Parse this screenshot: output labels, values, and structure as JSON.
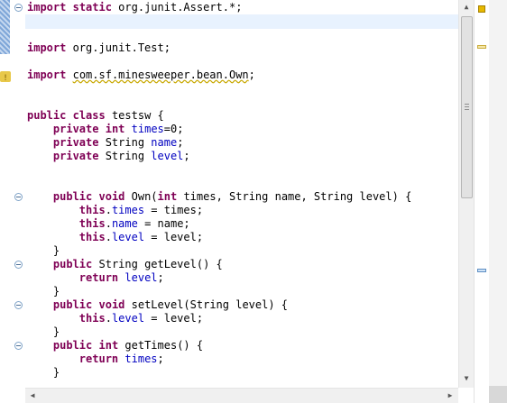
{
  "code_lines": [
    {
      "segments": [
        {
          "t": "import",
          "k": "kw"
        },
        {
          "t": " ",
          "k": ""
        },
        {
          "t": "static",
          "k": "kw"
        },
        {
          "t": " org.junit.Assert.*;",
          "k": ""
        }
      ]
    },
    {
      "segments": [
        {
          "t": "",
          "k": ""
        }
      ]
    },
    {
      "segments": [
        {
          "t": "",
          "k": ""
        }
      ]
    },
    {
      "segments": [
        {
          "t": "import",
          "k": "kw"
        },
        {
          "t": " org.junit.Test;",
          "k": ""
        }
      ]
    },
    {
      "segments": [
        {
          "t": "",
          "k": ""
        }
      ]
    },
    {
      "segments": [
        {
          "t": "import",
          "k": "kw"
        },
        {
          "t": " ",
          "k": ""
        },
        {
          "t": "com.sf.minesweeper.bean.Own",
          "k": "squig"
        },
        {
          "t": ";",
          "k": ""
        }
      ]
    },
    {
      "segments": [
        {
          "t": "",
          "k": ""
        }
      ]
    },
    {
      "segments": [
        {
          "t": "",
          "k": ""
        }
      ]
    },
    {
      "segments": [
        {
          "t": "public",
          "k": "kw"
        },
        {
          "t": " ",
          "k": ""
        },
        {
          "t": "class",
          "k": "kw"
        },
        {
          "t": " testsw {",
          "k": ""
        }
      ]
    },
    {
      "segments": [
        {
          "t": "    ",
          "k": ""
        },
        {
          "t": "private",
          "k": "kw"
        },
        {
          "t": " ",
          "k": ""
        },
        {
          "t": "int",
          "k": "kw"
        },
        {
          "t": " ",
          "k": ""
        },
        {
          "t": "times",
          "k": "fld"
        },
        {
          "t": "=0;",
          "k": ""
        }
      ]
    },
    {
      "segments": [
        {
          "t": "    ",
          "k": ""
        },
        {
          "t": "private",
          "k": "kw"
        },
        {
          "t": " String ",
          "k": ""
        },
        {
          "t": "name",
          "k": "fld"
        },
        {
          "t": ";",
          "k": ""
        }
      ]
    },
    {
      "segments": [
        {
          "t": "    ",
          "k": ""
        },
        {
          "t": "private",
          "k": "kw"
        },
        {
          "t": " String ",
          "k": ""
        },
        {
          "t": "level",
          "k": "fld"
        },
        {
          "t": ";",
          "k": ""
        }
      ]
    },
    {
      "segments": [
        {
          "t": "",
          "k": ""
        }
      ]
    },
    {
      "segments": [
        {
          "t": "",
          "k": ""
        }
      ]
    },
    {
      "segments": [
        {
          "t": "    ",
          "k": ""
        },
        {
          "t": "public",
          "k": "kw"
        },
        {
          "t": " ",
          "k": ""
        },
        {
          "t": "void",
          "k": "kw"
        },
        {
          "t": " Own(",
          "k": ""
        },
        {
          "t": "int",
          "k": "kw"
        },
        {
          "t": " times, String name, String level) {",
          "k": ""
        }
      ]
    },
    {
      "segments": [
        {
          "t": "        ",
          "k": ""
        },
        {
          "t": "this",
          "k": "kw"
        },
        {
          "t": ".",
          "k": ""
        },
        {
          "t": "times",
          "k": "fld"
        },
        {
          "t": " = times;",
          "k": ""
        }
      ]
    },
    {
      "segments": [
        {
          "t": "        ",
          "k": ""
        },
        {
          "t": "this",
          "k": "kw"
        },
        {
          "t": ".",
          "k": ""
        },
        {
          "t": "name",
          "k": "fld"
        },
        {
          "t": " = name;",
          "k": ""
        }
      ]
    },
    {
      "segments": [
        {
          "t": "        ",
          "k": ""
        },
        {
          "t": "this",
          "k": "kw"
        },
        {
          "t": ".",
          "k": ""
        },
        {
          "t": "level",
          "k": "fld"
        },
        {
          "t": " = level;",
          "k": ""
        }
      ]
    },
    {
      "segments": [
        {
          "t": "    }",
          "k": ""
        }
      ]
    },
    {
      "segments": [
        {
          "t": "    ",
          "k": ""
        },
        {
          "t": "public",
          "k": "kw"
        },
        {
          "t": " String getLevel() {",
          "k": ""
        }
      ]
    },
    {
      "segments": [
        {
          "t": "        ",
          "k": ""
        },
        {
          "t": "return",
          "k": "kw"
        },
        {
          "t": " ",
          "k": ""
        },
        {
          "t": "level",
          "k": "fld"
        },
        {
          "t": ";",
          "k": ""
        }
      ]
    },
    {
      "segments": [
        {
          "t": "    }",
          "k": ""
        }
      ]
    },
    {
      "segments": [
        {
          "t": "    ",
          "k": ""
        },
        {
          "t": "public",
          "k": "kw"
        },
        {
          "t": " ",
          "k": ""
        },
        {
          "t": "void",
          "k": "kw"
        },
        {
          "t": " setLevel(String level) {",
          "k": ""
        }
      ]
    },
    {
      "segments": [
        {
          "t": "        ",
          "k": ""
        },
        {
          "t": "this",
          "k": "kw"
        },
        {
          "t": ".",
          "k": ""
        },
        {
          "t": "level",
          "k": "fld"
        },
        {
          "t": " = level;",
          "k": ""
        }
      ]
    },
    {
      "segments": [
        {
          "t": "    }",
          "k": ""
        }
      ]
    },
    {
      "segments": [
        {
          "t": "    ",
          "k": ""
        },
        {
          "t": "public",
          "k": "kw"
        },
        {
          "t": " ",
          "k": ""
        },
        {
          "t": "int",
          "k": "kw"
        },
        {
          "t": " getTimes() {",
          "k": ""
        }
      ]
    },
    {
      "segments": [
        {
          "t": "        ",
          "k": ""
        },
        {
          "t": "return",
          "k": "kw"
        },
        {
          "t": " ",
          "k": ""
        },
        {
          "t": "times",
          "k": "fld"
        },
        {
          "t": ";",
          "k": ""
        }
      ]
    },
    {
      "segments": [
        {
          "t": "    }",
          "k": ""
        }
      ]
    }
  ],
  "colors": {
    "keyword": "#7f0055",
    "field": "#0000c0",
    "current_line": "#e8f2fe",
    "warning": "#e6b800"
  },
  "icons": {
    "scroll_up": "▲",
    "scroll_down": "▼",
    "scroll_left": "◀",
    "scroll_right": "▶"
  }
}
